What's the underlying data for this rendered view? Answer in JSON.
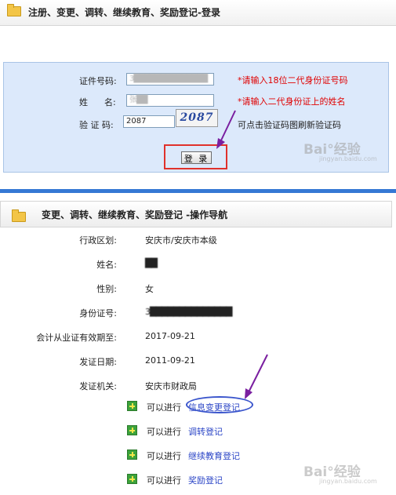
{
  "login_panel": {
    "title": "注册、变更、调转、继续教育、奖励登记-登录",
    "id_label": "证件号码:",
    "id_value": "3██████████████",
    "id_hint": "*请输入18位二代身份证号码",
    "name_label": "姓      名:",
    "name_value": "张██",
    "name_hint": "*请输入二代身份证上的姓名",
    "code_label": "验 证 码:",
    "code_value": "2087",
    "captcha_text": "2087",
    "code_hint": "可点击验证码图刷新验证码",
    "login_button": "登 录"
  },
  "nav_panel": {
    "title": "变更、调转、继续教育、奖励登记 -操作导航",
    "fields": [
      {
        "label": "行政区划:",
        "value": "安庆市/安庆市本级"
      },
      {
        "label": "姓名:",
        "value": "██"
      },
      {
        "label": "性别:",
        "value": "女"
      },
      {
        "label": "身份证号:",
        "value": "3██████████████"
      },
      {
        "label": "会计从业证有效期至:",
        "value": "2017-09-21"
      },
      {
        "label": "发证日期:",
        "value": "2011-09-21"
      },
      {
        "label": "发证机关:",
        "value": "安庆市财政局"
      }
    ],
    "action_prefix": "可以进行",
    "actions": [
      {
        "label": "信息变更登记"
      },
      {
        "label": "调转登记"
      },
      {
        "label": "继续教育登记"
      },
      {
        "label": "奖励登记"
      }
    ]
  },
  "watermark": {
    "brand": "Bai°经验",
    "domain": "jingyan.baidu.com"
  },
  "colors": {
    "accent_blue": "#3578d4",
    "login_bg": "#dce9fb",
    "highlight_red": "#e0312b",
    "hint_red": "#e00000",
    "link_blue": "#2a44c6",
    "annotation_purple": "#7a1fa0",
    "plus_green": "#3ca33c"
  }
}
